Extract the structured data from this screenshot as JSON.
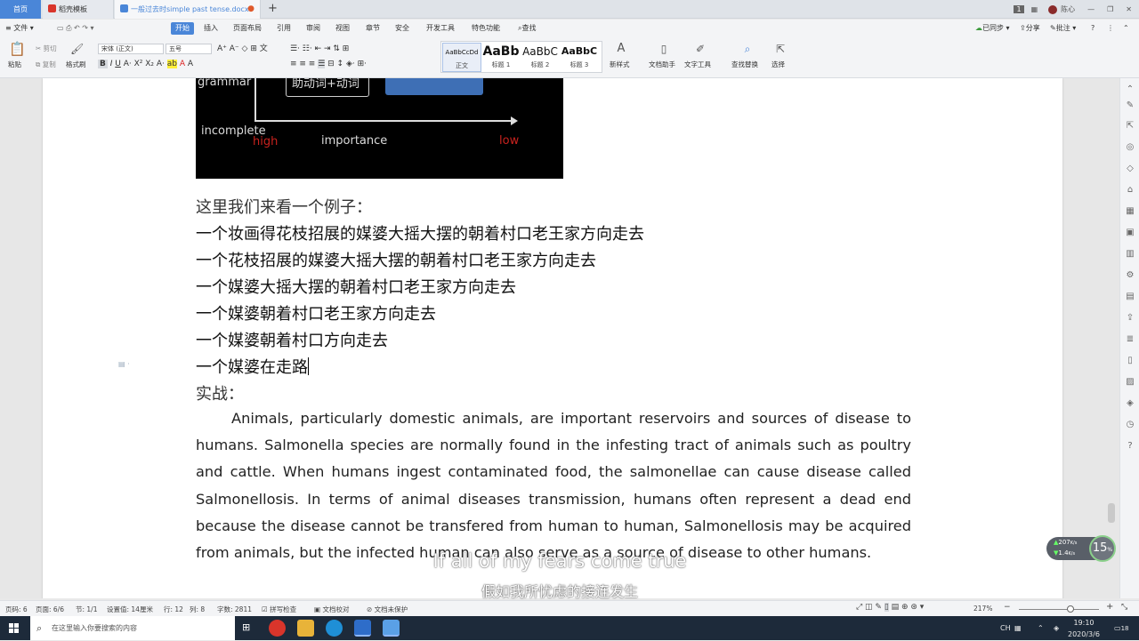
{
  "tabs": {
    "home": "首页",
    "template": "稻壳模板",
    "doc": "一般过去时simple past tense.docx"
  },
  "titlebar": {
    "badge": "1",
    "user": "陈心"
  },
  "menu": {
    "file": "文件",
    "items": [
      "开始",
      "插入",
      "页面布局",
      "引用",
      "审阅",
      "视图",
      "章节",
      "安全",
      "开发工具",
      "特色功能"
    ],
    "search": "查找",
    "sync": "已同步",
    "share": "分享",
    "comment": "批注",
    "help": "?"
  },
  "ribbon": {
    "paste": "粘贴",
    "cut": "剪切",
    "copy": "复制",
    "format_painter": "格式刷",
    "font_name": "宋体 (正文)",
    "font_size": "五号",
    "styles": [
      {
        "sample": "AaBbCcDd",
        "name": "正文"
      },
      {
        "sample": "AaBb",
        "name": "标题 1"
      },
      {
        "sample": "AaBbC",
        "name": "标题 2"
      },
      {
        "sample": "AaBbC",
        "name": "标题 3"
      }
    ],
    "new_style": "新样式",
    "assistant": "文档助手",
    "text_tools": "文字工具",
    "find_replace": "查找替换",
    "select": "选择"
  },
  "figure": {
    "grammar": "grammar",
    "box_label": "助动词+动词",
    "incomplete": "incomplete",
    "high": "high",
    "importance": "importance",
    "low": "low"
  },
  "doc": {
    "lead": "这里我们来看一个例子：",
    "lines": [
      "一个妆画得花枝招展的媒婆大摇大摆的朝着村口老王家方向走去",
      "一个花枝招展的媒婆大摇大摆的朝着村口老王家方向走去",
      "一个媒婆大摇大摆的朝着村口老王家方向走去",
      "一个媒婆朝着村口老王家方向走去",
      "一个媒婆朝着村口方向走去",
      "一个媒婆在走路"
    ],
    "practice": "实战：",
    "paragraph": "Animals, particularly domestic animals, are important reservoirs and sources of disease to humans. Salmonella species are normally found in the infesting tract of animals such as poultry and cattle. When humans ingest contaminated food, the salmonellae can cause disease called Salmonellosis. In terms of animal diseases transmission, humans often represent a dead end because the disease cannot be transfered from human to human, Salmonellosis may be acquired from animals, but the infected human can also serve as a source of disease to other humans."
  },
  "subtitles": {
    "en": "If all of my fears come true",
    "zh": "假如我所忧虑的接连发生"
  },
  "speed": {
    "up": "207",
    "down": "1.4",
    "percent": "15"
  },
  "status": {
    "page": "页码: 6",
    "pages": "页面: 6/6",
    "section": "节: 1/1",
    "setting": "设置值: 14厘米",
    "row": "行: 12",
    "col": "列: 8",
    "words": "字数: 2811",
    "spell": "拼写检查",
    "proof": "文档校对",
    "protect": "文档未保护",
    "zoom": "217%"
  },
  "taskbar": {
    "search": "在这里输入你要搜索的内容",
    "ime": "CH",
    "time": "19:10",
    "date": "2020/3/6",
    "notify": "18"
  },
  "colors": {
    "accent": "#4a86d8",
    "figure_red": "#c8221e",
    "figure_blue": "#3e6fb5"
  }
}
